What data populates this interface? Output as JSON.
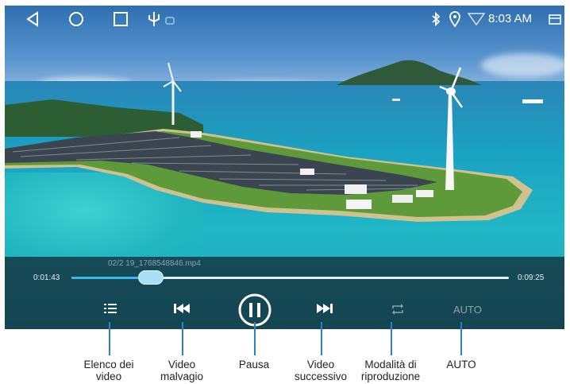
{
  "status_bar": {
    "nav_icons": [
      "back-icon",
      "home-icon",
      "recents-icon",
      "usb-icon"
    ],
    "status_icons": [
      "bluetooth-icon",
      "location-icon",
      "wifi-icon"
    ],
    "time": "8:03 AM",
    "window_icon": "window-icon"
  },
  "player": {
    "filename": "02/2  19_1768548846.mp4",
    "elapsed": "0:01:43",
    "total": "0:09:25",
    "progress": 0.182,
    "accent_color": "#39b9e8",
    "controls": {
      "list_icon": "list-icon",
      "prev_icon": "skip-previous-icon",
      "pause_icon": "pause-icon",
      "next_icon": "skip-next-icon",
      "repeat_icon": "repeat-icon",
      "auto_label": "AUTO"
    }
  },
  "annotations": [
    {
      "line1": "Elenco dei",
      "line2": "video"
    },
    {
      "line1": "Video",
      "line2": "malvagio"
    },
    {
      "line1": "Pausa",
      "line2": ""
    },
    {
      "line1": "Video",
      "line2": "successivo"
    },
    {
      "line1": "Modalità di",
      "line2": "riproduzione"
    },
    {
      "line1": "AUTO",
      "line2": ""
    }
  ]
}
